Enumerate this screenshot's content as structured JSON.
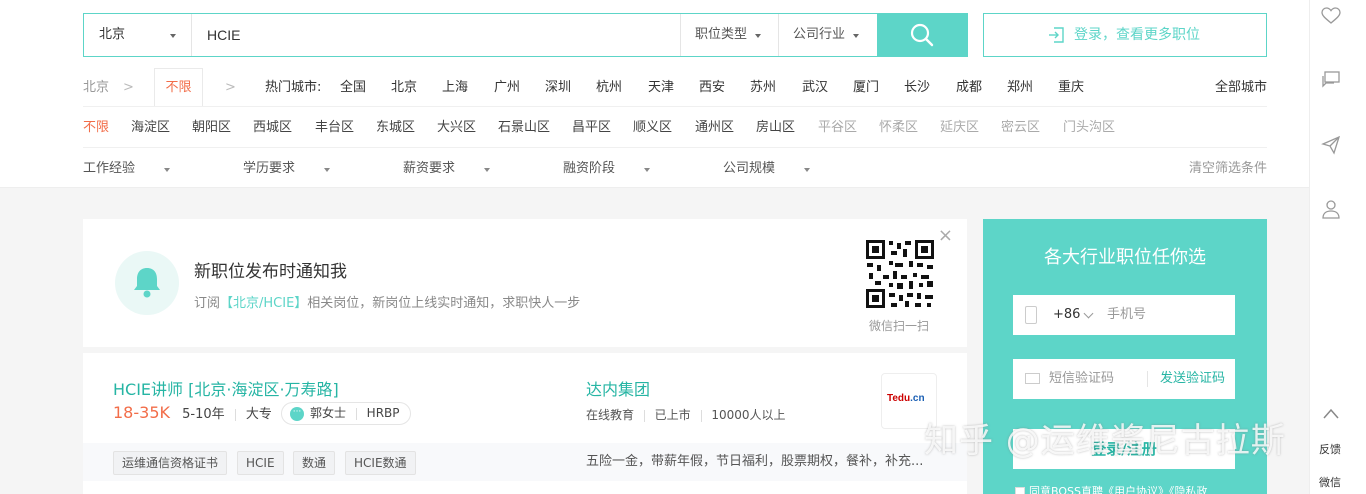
{
  "search": {
    "city": "北京",
    "keyword": "HCIE",
    "job_type_label": "职位类型",
    "industry_label": "公司行业",
    "login_label": "登录，查看更多职位"
  },
  "city_row": {
    "current": "北京",
    "active_tab": "不限",
    "hot_label": "热门城市:",
    "cities": [
      "全国",
      "北京",
      "上海",
      "广州",
      "深圳",
      "杭州",
      "天津",
      "西安",
      "苏州",
      "武汉",
      "厦门",
      "长沙",
      "成都",
      "郑州",
      "重庆"
    ],
    "all_cities": "全部城市"
  },
  "districts": {
    "active": "不限",
    "items": [
      "海淀区",
      "朝阳区",
      "西城区",
      "丰台区",
      "东城区",
      "大兴区",
      "石景山区",
      "昌平区",
      "顺义区",
      "通州区",
      "房山区",
      "平谷区",
      "怀柔区",
      "延庆区",
      "密云区",
      "门头沟区"
    ]
  },
  "filters": {
    "items": [
      "工作经验",
      "学历要求",
      "薪资要求",
      "融资阶段",
      "公司规模"
    ],
    "clear": "清空筛选条件"
  },
  "notify": {
    "title": "新职位发布时通知我",
    "sub_prefix": "订阅",
    "sub_highlight": "【北京/HCIE】",
    "sub_suffix": "相关岗位，新岗位上线实时通知，求职快人一步",
    "qr_label": "微信扫一扫"
  },
  "job": {
    "title": "HCIE讲师  [北京·海淀区·万寿路]",
    "salary": "18-35K",
    "experience": "5-10年",
    "education": "大专",
    "recruiter": "郭女士",
    "recruiter_role": "HRBP",
    "company": "达内集团",
    "industry": "在线教育",
    "stage": "已上市",
    "size": "10000人以上",
    "logo_text_a": "Tedu",
    "logo_text_b": ".cn",
    "tags": [
      "运维通信资格证书",
      "HCIE",
      "数通",
      "HCIE数通"
    ],
    "benefits": "五险一金，带薪年假，节日福利，股票期权，餐补，补充..."
  },
  "side_panel": {
    "title": "各大行业职位任你选",
    "country_code": "+86",
    "phone_placeholder": "手机号",
    "code_placeholder": "短信验证码",
    "send_code": "发送验证码",
    "register": "登录/注册",
    "agreement": "同意BOSS直聘《用户协议》《隐私政"
  },
  "right_bar": {
    "feedback": "反馈",
    "wechat": "微信"
  },
  "watermark": "知乎 @运维酱尼古拉斯",
  "colors": {
    "accent": "#5dd5c8",
    "accent_text": "#26b5a4",
    "salary": "#f26d49",
    "active": "#f26d49"
  }
}
